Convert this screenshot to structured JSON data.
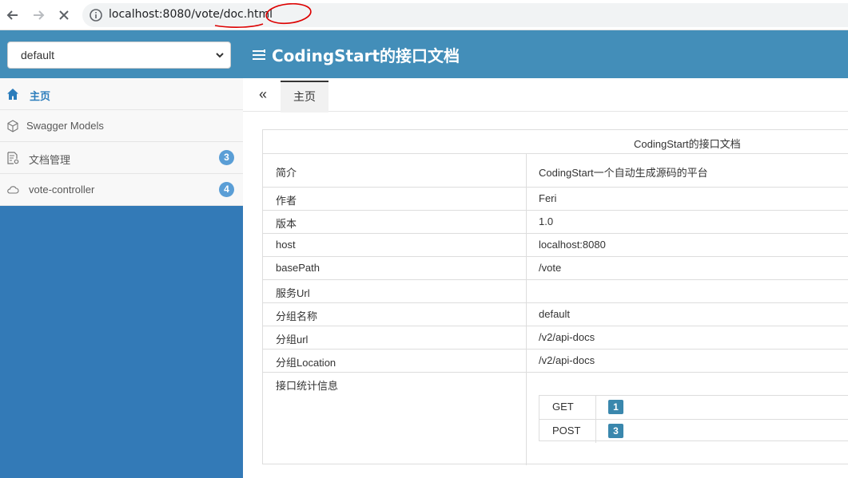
{
  "browser": {
    "url": "localhost:8080/vote/doc.html",
    "icons": [
      "back-arrow-icon",
      "forward-arrow-icon",
      "stop-loading-icon",
      "site-info-icon"
    ]
  },
  "header": {
    "group_select_value": "default",
    "title": "CodingStart的接口文档",
    "colors": {
      "bar": "#438eb9",
      "sidebar": "#337ab7"
    }
  },
  "sidebar": {
    "items": [
      {
        "label": "主页",
        "icon": "home-icon",
        "active": true
      },
      {
        "label": "Swagger Models",
        "icon": "cube-icon"
      },
      {
        "label": "文档管理",
        "icon": "document-settings-icon",
        "badge": "3"
      },
      {
        "label": "vote-controller",
        "icon": "cloud-icon",
        "badge": "4"
      }
    ]
  },
  "tabs": {
    "collapse_label": "«",
    "items": [
      {
        "label": "主页"
      }
    ]
  },
  "doc": {
    "title": "CodingStart的接口文档",
    "rows": [
      {
        "key": "简介",
        "value": "CodingStart一个自动生成源码的平台"
      },
      {
        "key": "作者",
        "value": "Feri"
      },
      {
        "key": "版本",
        "value": "1.0"
      },
      {
        "key": "host",
        "value": "localhost:8080"
      },
      {
        "key": "basePath",
        "value": "/vote"
      },
      {
        "key": "服务Url",
        "value": ""
      },
      {
        "key": "分组名称",
        "value": "default"
      },
      {
        "key": "分组url",
        "value": "/v2/api-docs"
      },
      {
        "key": "分组Location",
        "value": "/v2/api-docs"
      },
      {
        "key": "接口统计信息",
        "value": ""
      }
    ],
    "stats": [
      {
        "method": "GET",
        "count": "1"
      },
      {
        "method": "POST",
        "count": "3"
      }
    ]
  }
}
